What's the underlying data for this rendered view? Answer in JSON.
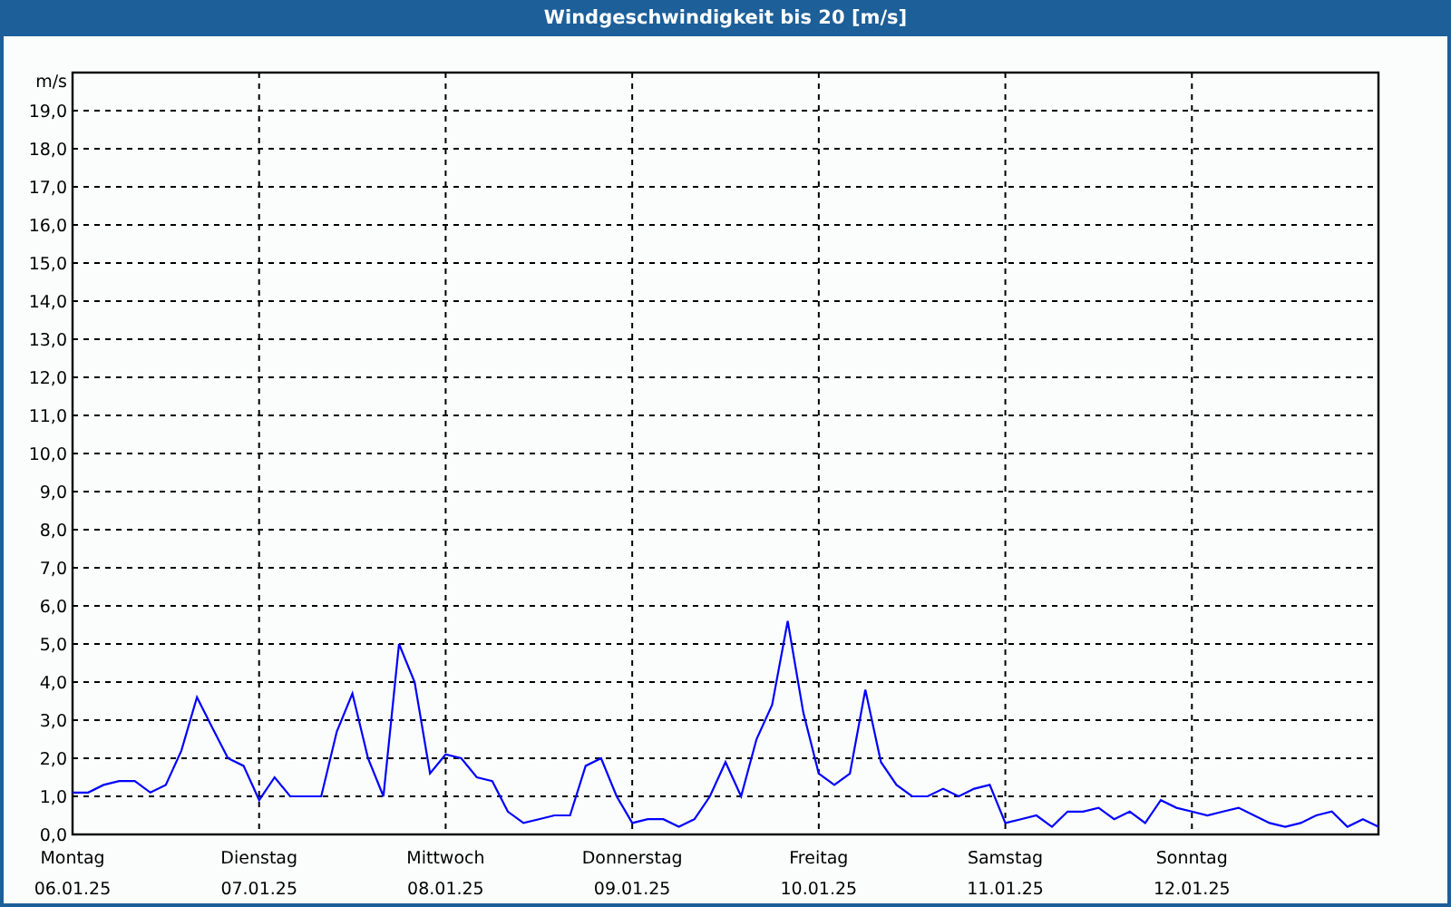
{
  "window": {
    "title": "Windgeschwindigkeit bis 20 [m/s]"
  },
  "chart": {
    "chart_data": {
      "type": "line",
      "grid": true,
      "ylabel": "m/s",
      "ylim": [
        0,
        20
      ],
      "categories": [
        "Montag",
        null,
        null,
        null,
        null,
        null,
        null,
        null,
        null,
        null,
        null,
        null,
        "Dienstag",
        null,
        null,
        null,
        null,
        null,
        null,
        null,
        null,
        null,
        null,
        null,
        "Mittwoch",
        null,
        null,
        null,
        null,
        null,
        null,
        null,
        null,
        null,
        null,
        null,
        "Donnerstag",
        null,
        null,
        null,
        null,
        null,
        null,
        null,
        null,
        null,
        null,
        null,
        "Freitag",
        null,
        null,
        null,
        null,
        null,
        null,
        null,
        null,
        null,
        null,
        null,
        "Samstag",
        null,
        null,
        null,
        null,
        null,
        null,
        null,
        null,
        null,
        null,
        null,
        "Sonntag",
        null,
        null,
        null,
        null,
        null,
        null,
        null,
        null,
        null,
        null,
        null,
        null
      ],
      "yticks": [
        {
          "value": 0,
          "label": "0,0"
        },
        {
          "value": 1,
          "label": "1,0"
        },
        {
          "value": 2,
          "label": "2,0"
        },
        {
          "value": 3,
          "label": "3,0"
        },
        {
          "value": 4,
          "label": "4,0"
        },
        {
          "value": 5,
          "label": "5,0"
        },
        {
          "value": 6,
          "label": "6,0"
        },
        {
          "value": 7,
          "label": "7,0"
        },
        {
          "value": 8,
          "label": "8,0"
        },
        {
          "value": 9,
          "label": "9,0"
        },
        {
          "value": 10,
          "label": "10,0"
        },
        {
          "value": 11,
          "label": "11,0"
        },
        {
          "value": 12,
          "label": "12,0"
        },
        {
          "value": 13,
          "label": "13,0"
        },
        {
          "value": 14,
          "label": "14,0"
        },
        {
          "value": 15,
          "label": "15,0"
        },
        {
          "value": 16,
          "label": "16,0"
        },
        {
          "value": 17,
          "label": "17,0"
        },
        {
          "value": 18,
          "label": "18,0"
        },
        {
          "value": 19,
          "label": "19,0"
        }
      ],
      "series": [
        {
          "color": "#0000ff",
          "values": [
            1.1,
            1.1,
            1.3,
            1.4,
            1.4,
            1.1,
            1.3,
            2.2,
            3.6,
            2.8,
            2.0,
            1.8,
            0.9,
            1.5,
            1.0,
            1.0,
            1.0,
            2.7,
            3.7,
            2.0,
            1.0,
            5.0,
            4.0,
            1.6,
            2.1,
            2.0,
            1.5,
            1.4,
            0.6,
            0.3,
            0.4,
            0.5,
            0.5,
            1.8,
            2.0,
            1.0,
            0.3,
            0.4,
            0.4,
            0.2,
            0.4,
            1.0,
            1.9,
            1.0,
            2.5,
            3.4,
            5.6,
            3.2,
            1.6,
            1.3,
            1.6,
            3.8,
            1.9,
            1.3,
            1.0,
            1.0,
            1.2,
            1.0,
            1.2,
            1.3,
            0.3,
            0.4,
            0.5,
            0.2,
            0.6,
            0.6,
            0.7,
            0.4,
            0.6,
            0.3,
            0.9,
            0.7,
            0.6,
            0.5,
            0.6,
            0.7,
            0.5,
            0.3,
            0.2,
            0.3,
            0.5,
            0.6,
            0.2,
            0.4,
            0.2
          ]
        }
      ]
    },
    "dates": [
      "06.01.25",
      "07.01.25",
      "08.01.25",
      "09.01.25",
      "10.01.25",
      "11.01.25",
      "12.01.25"
    ]
  }
}
